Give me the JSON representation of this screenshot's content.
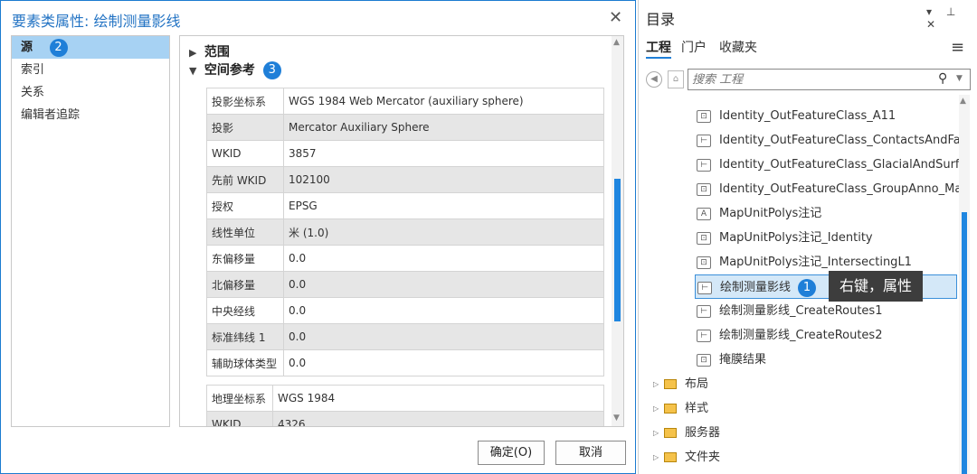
{
  "dialog": {
    "title": "要素类属性: 绘制测量影线",
    "close_glyph": "✕",
    "nav": [
      {
        "label": "源",
        "badge": "2"
      },
      {
        "label": "索引"
      },
      {
        "label": "关系"
      },
      {
        "label": "编辑者追踪"
      }
    ],
    "sections": {
      "extent": "范围",
      "spatial_ref": "空间参考",
      "spatial_ref_badge": "3"
    },
    "projected_rows": [
      {
        "key": "投影坐标系",
        "value": "WGS 1984 Web Mercator (auxiliary sphere)"
      },
      {
        "key": "投影",
        "value": "Mercator Auxiliary Sphere"
      },
      {
        "key": "WKID",
        "value": "3857"
      },
      {
        "key": "先前 WKID",
        "value": "102100"
      },
      {
        "key": "授权",
        "value": "EPSG"
      },
      {
        "key": "线性单位",
        "value": "米 (1.0)"
      },
      {
        "key": "东偏移量",
        "value": "0.0"
      },
      {
        "key": "北偏移量",
        "value": "0.0"
      },
      {
        "key": "中央经线",
        "value": "0.0"
      },
      {
        "key": "标准纬线 1",
        "value": "0.0"
      },
      {
        "key": "辅助球体类型",
        "value": "0.0"
      }
    ],
    "geographic_rows": [
      {
        "key": "地理坐标系",
        "value": "WGS 1984"
      },
      {
        "key": "WKID",
        "value": "4326"
      }
    ],
    "ok_label": "确定(O)",
    "cancel_label": "取消"
  },
  "catalog": {
    "title": "目录",
    "ctrl_glyphs": "▾ ⊥ ✕",
    "tabs": [
      "工程",
      "门户",
      "收藏夹"
    ],
    "search_placeholder": "搜索 工程",
    "items": [
      {
        "icon": "polygon",
        "label": "Identity_OutFeatureClass_A11"
      },
      {
        "icon": "line",
        "label": "Identity_OutFeatureClass_ContactsAndFa"
      },
      {
        "icon": "line",
        "label": "Identity_OutFeatureClass_GlacialAndSurfi"
      },
      {
        "icon": "polygon",
        "label": "Identity_OutFeatureClass_GroupAnno_Ma"
      },
      {
        "icon": "annotation",
        "label": "MapUnitPolys注记"
      },
      {
        "icon": "polygon",
        "label": "MapUnitPolys注记_Identity"
      },
      {
        "icon": "polygon",
        "label": "MapUnitPolys注记_IntersectingL1"
      },
      {
        "icon": "line",
        "label": "绘制测量影线",
        "badge": "1"
      },
      {
        "icon": "line",
        "label": "绘制测量影线_CreateRoutes1"
      },
      {
        "icon": "line",
        "label": "绘制测量影线_CreateRoutes2"
      },
      {
        "icon": "polygon",
        "label": "掩膜结果"
      }
    ],
    "folders": [
      "布局",
      "样式",
      "服务器",
      "文件夹"
    ],
    "tooltip": "右键，属性"
  }
}
